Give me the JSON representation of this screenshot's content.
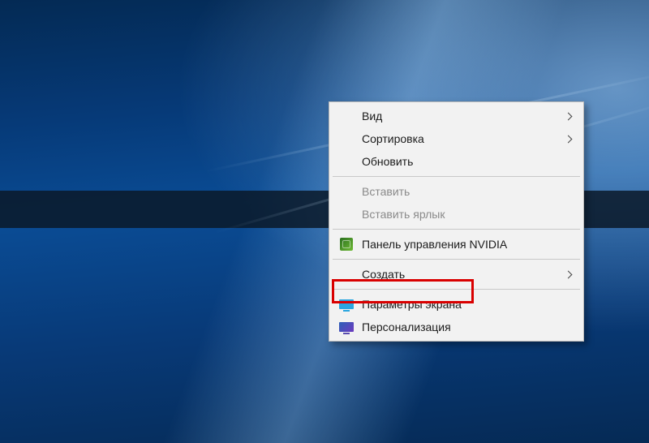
{
  "context_menu": {
    "view": {
      "label": "Вид",
      "has_submenu": true
    },
    "sort": {
      "label": "Сортировка",
      "has_submenu": true
    },
    "refresh": {
      "label": "Обновить"
    },
    "paste": {
      "label": "Вставить",
      "enabled": false
    },
    "paste_shortcut": {
      "label": "Вставить ярлык",
      "enabled": false
    },
    "nvidia_cp": {
      "label": "Панель управления NVIDIA",
      "icon": "nvidia-icon"
    },
    "create": {
      "label": "Создать",
      "has_submenu": true
    },
    "display_settings": {
      "label": "Параметры экрана",
      "icon": "display-monitor-icon",
      "highlighted": true
    },
    "personalize": {
      "label": "Персонализация",
      "icon": "personalization-icon"
    }
  }
}
